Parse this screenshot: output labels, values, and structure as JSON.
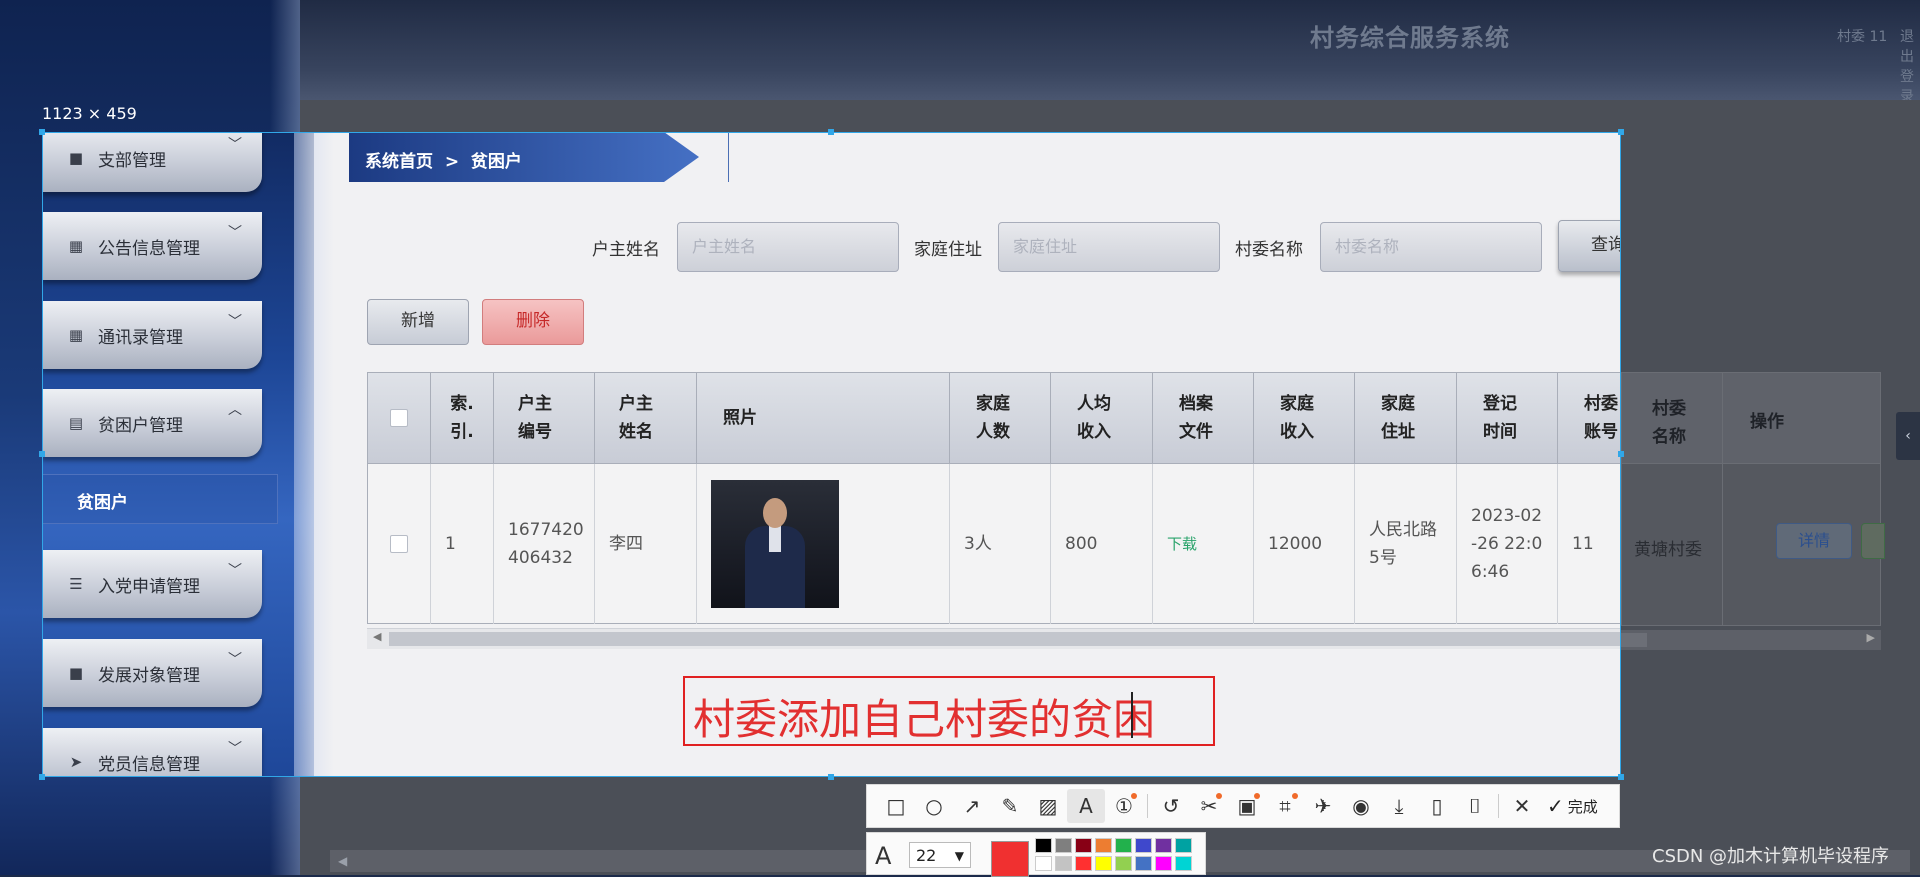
{
  "app": {
    "title": "村务综合服务系统",
    "user": "村委 11",
    "logout": "退出登录"
  },
  "capture": {
    "size_label": "1123 × 459"
  },
  "sidebar": {
    "items": [
      {
        "label": "支部管理",
        "icon": "briefcase-icon",
        "chevron": "﹀"
      },
      {
        "label": "公告信息管理",
        "icon": "grid-icon",
        "chevron": "﹀"
      },
      {
        "label": "通讯录管理",
        "icon": "grid-icon",
        "chevron": "﹀"
      },
      {
        "label": "贫困户管理",
        "icon": "clipboard-icon",
        "chevron": "︿"
      },
      {
        "label": "入党申请管理",
        "icon": "list-icon",
        "chevron": "﹀"
      },
      {
        "label": "发展对象管理",
        "icon": "briefcase-icon",
        "chevron": "﹀"
      },
      {
        "label": "党员信息管理",
        "icon": "send-icon",
        "chevron": "﹀"
      }
    ],
    "submenu_active": "贫困户"
  },
  "breadcrumb": {
    "text": "系统首页  >  贫困户"
  },
  "search": {
    "owner_label": "户主姓名",
    "owner_placeholder": "户主姓名",
    "address_label": "家庭住址",
    "address_placeholder": "家庭住址",
    "committee_label": "村委名称",
    "committee_placeholder": "村委名称",
    "query_button": "查询"
  },
  "actions": {
    "add": "新增",
    "delete": "删除"
  },
  "table": {
    "headers": {
      "index": "索.\n引.",
      "code": "户主\n编号",
      "name": "户主\n姓名",
      "photo": "照片",
      "members": "家庭\n人数",
      "per_income": "人均\n收入",
      "file": "档案\n文件",
      "family_income": "家庭\n收入",
      "address": "家庭\n住址",
      "reg_time": "登记\n时间",
      "account": "村委\n账号",
      "committee": "村委\n名称",
      "ops": "操作"
    },
    "rows": [
      {
        "index": "1",
        "code": "1677420\n406432",
        "name": "李四",
        "members": "3人",
        "per_income": "800",
        "file": "下载",
        "family_income": "12000",
        "address": "人民北路\n5号",
        "reg_time": "2023-02\n-26 22:0\n6:46",
        "account": "11",
        "committee": "黄塘村委",
        "detail_button": "详情"
      }
    ]
  },
  "annotation": {
    "text": "村委添加自己村委的贫困",
    "color": "#e23030"
  },
  "toolbar": {
    "tools": [
      "rectangle-icon",
      "ellipse-icon",
      "arrow-icon",
      "pen-icon",
      "mosaic-icon",
      "text-icon",
      "number-icon",
      "undo-icon",
      "cut-icon",
      "ocr-icon",
      "scan-icon",
      "pin-icon",
      "record-icon",
      "download-icon",
      "save-icon",
      "bookmark-icon",
      "close-icon"
    ],
    "done": "完成",
    "font_size": "22",
    "current_color": "#f03030",
    "palette": [
      "#000000",
      "#7f7f7f",
      "#880015",
      "#ed7d31",
      "#22b14c",
      "#3f48cc",
      "#7030a0",
      "#00a2a2",
      "#ffffff",
      "#c3c3c3",
      "#ff3030",
      "#ffff00",
      "#92d050",
      "#4472c4",
      "#ff00ff",
      "#00d4d4"
    ]
  },
  "watermark": "CSDN @加木计算机毕设程序"
}
